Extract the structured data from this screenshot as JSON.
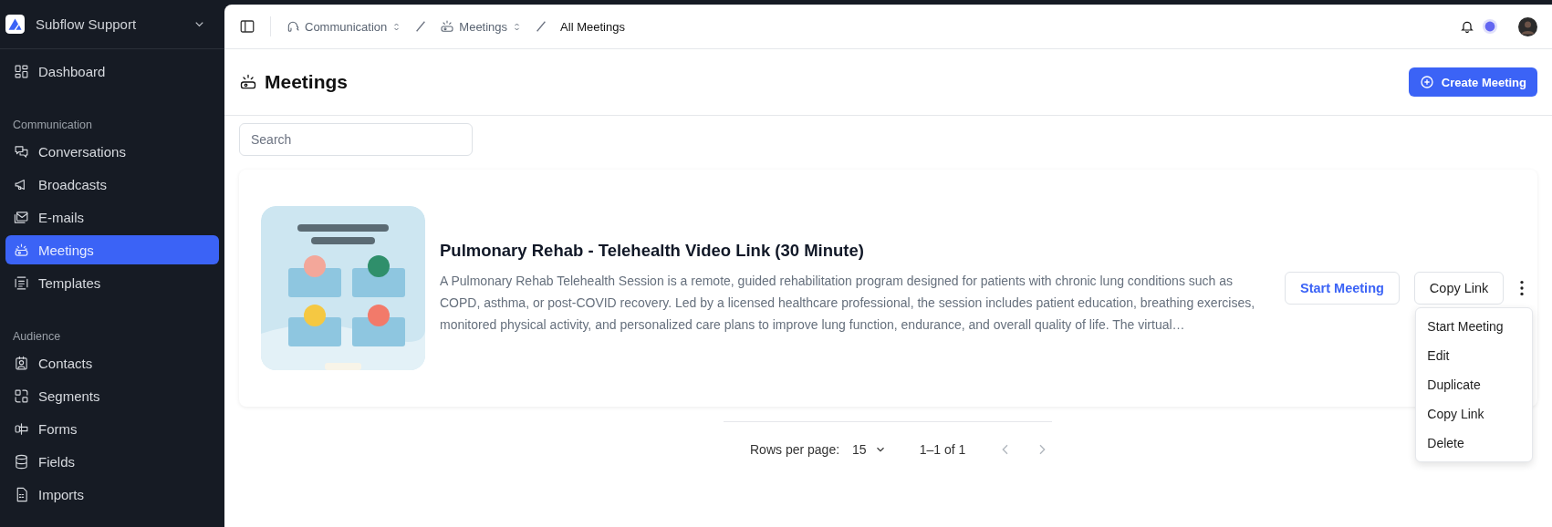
{
  "sidebar": {
    "workspace": "Subflow Support",
    "sections": [
      {
        "items": [
          {
            "label": "Dashboard",
            "selected": false
          }
        ]
      },
      {
        "title": "Communication",
        "items": [
          {
            "label": "Conversations",
            "selected": false
          },
          {
            "label": "Broadcasts",
            "selected": false
          },
          {
            "label": "E-mails",
            "selected": false
          },
          {
            "label": "Meetings",
            "selected": true
          },
          {
            "label": "Templates",
            "selected": false
          }
        ]
      },
      {
        "title": "Audience",
        "items": [
          {
            "label": "Contacts",
            "selected": false
          },
          {
            "label": "Segments",
            "selected": false
          },
          {
            "label": "Forms",
            "selected": false
          },
          {
            "label": "Fields",
            "selected": false
          },
          {
            "label": "Imports",
            "selected": false
          }
        ]
      }
    ]
  },
  "topbar": {
    "breadcrumbs": [
      {
        "label": "Communication",
        "dropdown": true,
        "selected": false
      },
      {
        "label": "Meetings",
        "dropdown": true,
        "selected": false
      },
      {
        "label": "All Meetings",
        "dropdown": false,
        "selected": true
      }
    ]
  },
  "page": {
    "title": "Meetings",
    "create_button": "Create Meeting",
    "search": {
      "placeholder": "Search"
    }
  },
  "meetings": [
    {
      "title": "Pulmonary Rehab - Telehealth Video Link (30 Minute)",
      "description": "A Pulmonary Rehab Telehealth Session is a remote, guided rehabilitation program designed for patients with chronic lung conditions such as COPD, asthma, or post-COVID recovery. Led by a licensed healthcare professional, the session includes patient education, breathing exercises, monitored physical activity, and personalized care plans to improve lung function, endurance, and overall quality of life. The virtual…",
      "primary_button": "Start Meeting",
      "secondary_button": "Copy Link",
      "menu_open": true,
      "menu": [
        "Start Meeting",
        "Edit",
        "Duplicate",
        "Copy Link",
        "Delete"
      ]
    }
  ],
  "pagination": {
    "rows_label": "Rows per page:",
    "rows_value": "15",
    "range": "1–1 of 1",
    "previous_disabled": true,
    "next_disabled": true
  }
}
